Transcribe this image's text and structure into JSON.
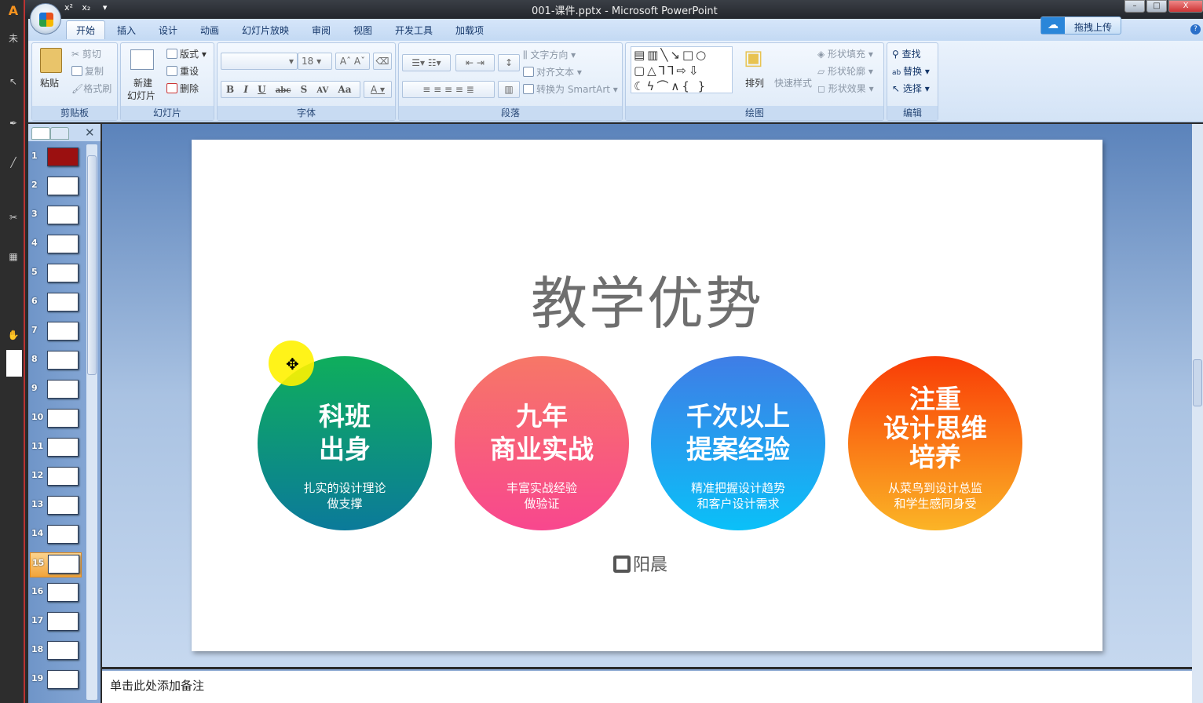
{
  "window": {
    "title": "001-课件.pptx - Microsoft PowerPoint",
    "qat": [
      "x²",
      "x₂"
    ],
    "min": "–",
    "max": "□",
    "close": "X"
  },
  "upload": {
    "label": "拖拽上传",
    "icon": "baidu-cloud-icon"
  },
  "tabs": [
    "开始",
    "插入",
    "设计",
    "动画",
    "幻灯片放映",
    "审阅",
    "视图",
    "开发工具",
    "加载项"
  ],
  "active_tab": "开始",
  "groups": {
    "clipboard": {
      "label": "剪贴板",
      "paste": "粘贴",
      "cut": "剪切",
      "copy": "复制",
      "format": "格式刷"
    },
    "slides": {
      "label": "幻灯片",
      "new1": "新建",
      "new2": "幻灯片",
      "layout": "版式",
      "reset": "重设",
      "delete": "删除"
    },
    "font": {
      "label": "字体",
      "size": "18",
      "bold": "B",
      "italic": "I",
      "underline": "U",
      "strike": "abc",
      "shadow": "S",
      "spacing": "AV",
      "case": "Aa",
      "color": "A",
      "grow": "A",
      "shrink": "A"
    },
    "paragraph": {
      "label": "段落",
      "text_dir": "文字方向",
      "align_text": "对齐文本",
      "smartart": "转换为 SmartArt"
    },
    "drawing": {
      "label": "绘图",
      "arrange": "排列",
      "quick_styles": "快速样式",
      "fill": "形状填充",
      "outline": "形状轮廓",
      "effects": "形状效果"
    },
    "editing": {
      "label": "编辑",
      "find": "查找",
      "replace": "替换",
      "select": "选择"
    }
  },
  "slides": {
    "count_visible": 19,
    "selected": 15,
    "numbers": [
      "1",
      "2",
      "3",
      "4",
      "5",
      "6",
      "7",
      "8",
      "9",
      "10",
      "11",
      "12",
      "13",
      "14",
      "15",
      "16",
      "17",
      "18",
      "19"
    ]
  },
  "slide": {
    "title": "教学优势",
    "circles": [
      {
        "h1": "科班",
        "h2": "出身",
        "s1": "扎实的设计理论",
        "s2": "做支撑",
        "colors": [
          "#0fae5c",
          "#0b7a9a"
        ]
      },
      {
        "h1": "九年",
        "h2": "商业实战",
        "s1": "丰富实战经验",
        "s2": "做验证",
        "colors": [
          "#f77767",
          "#f8478e"
        ]
      },
      {
        "h1": "千次以上",
        "h2": "提案经验",
        "s1": "精准把握设计趋势",
        "s2": "和客户设计需求",
        "colors": [
          "#3f7de6",
          "#0ac0f8"
        ]
      },
      {
        "h1": "注重",
        "h2": "设计思维",
        "h3": "培养",
        "s1": "从菜鸟到设计总监",
        "s2": "和学生感同身受",
        "colors": [
          "#f93c06",
          "#fbb426"
        ]
      }
    ],
    "logo": "阳晨"
  },
  "notes": {
    "placeholder": "单击此处添加备注"
  }
}
